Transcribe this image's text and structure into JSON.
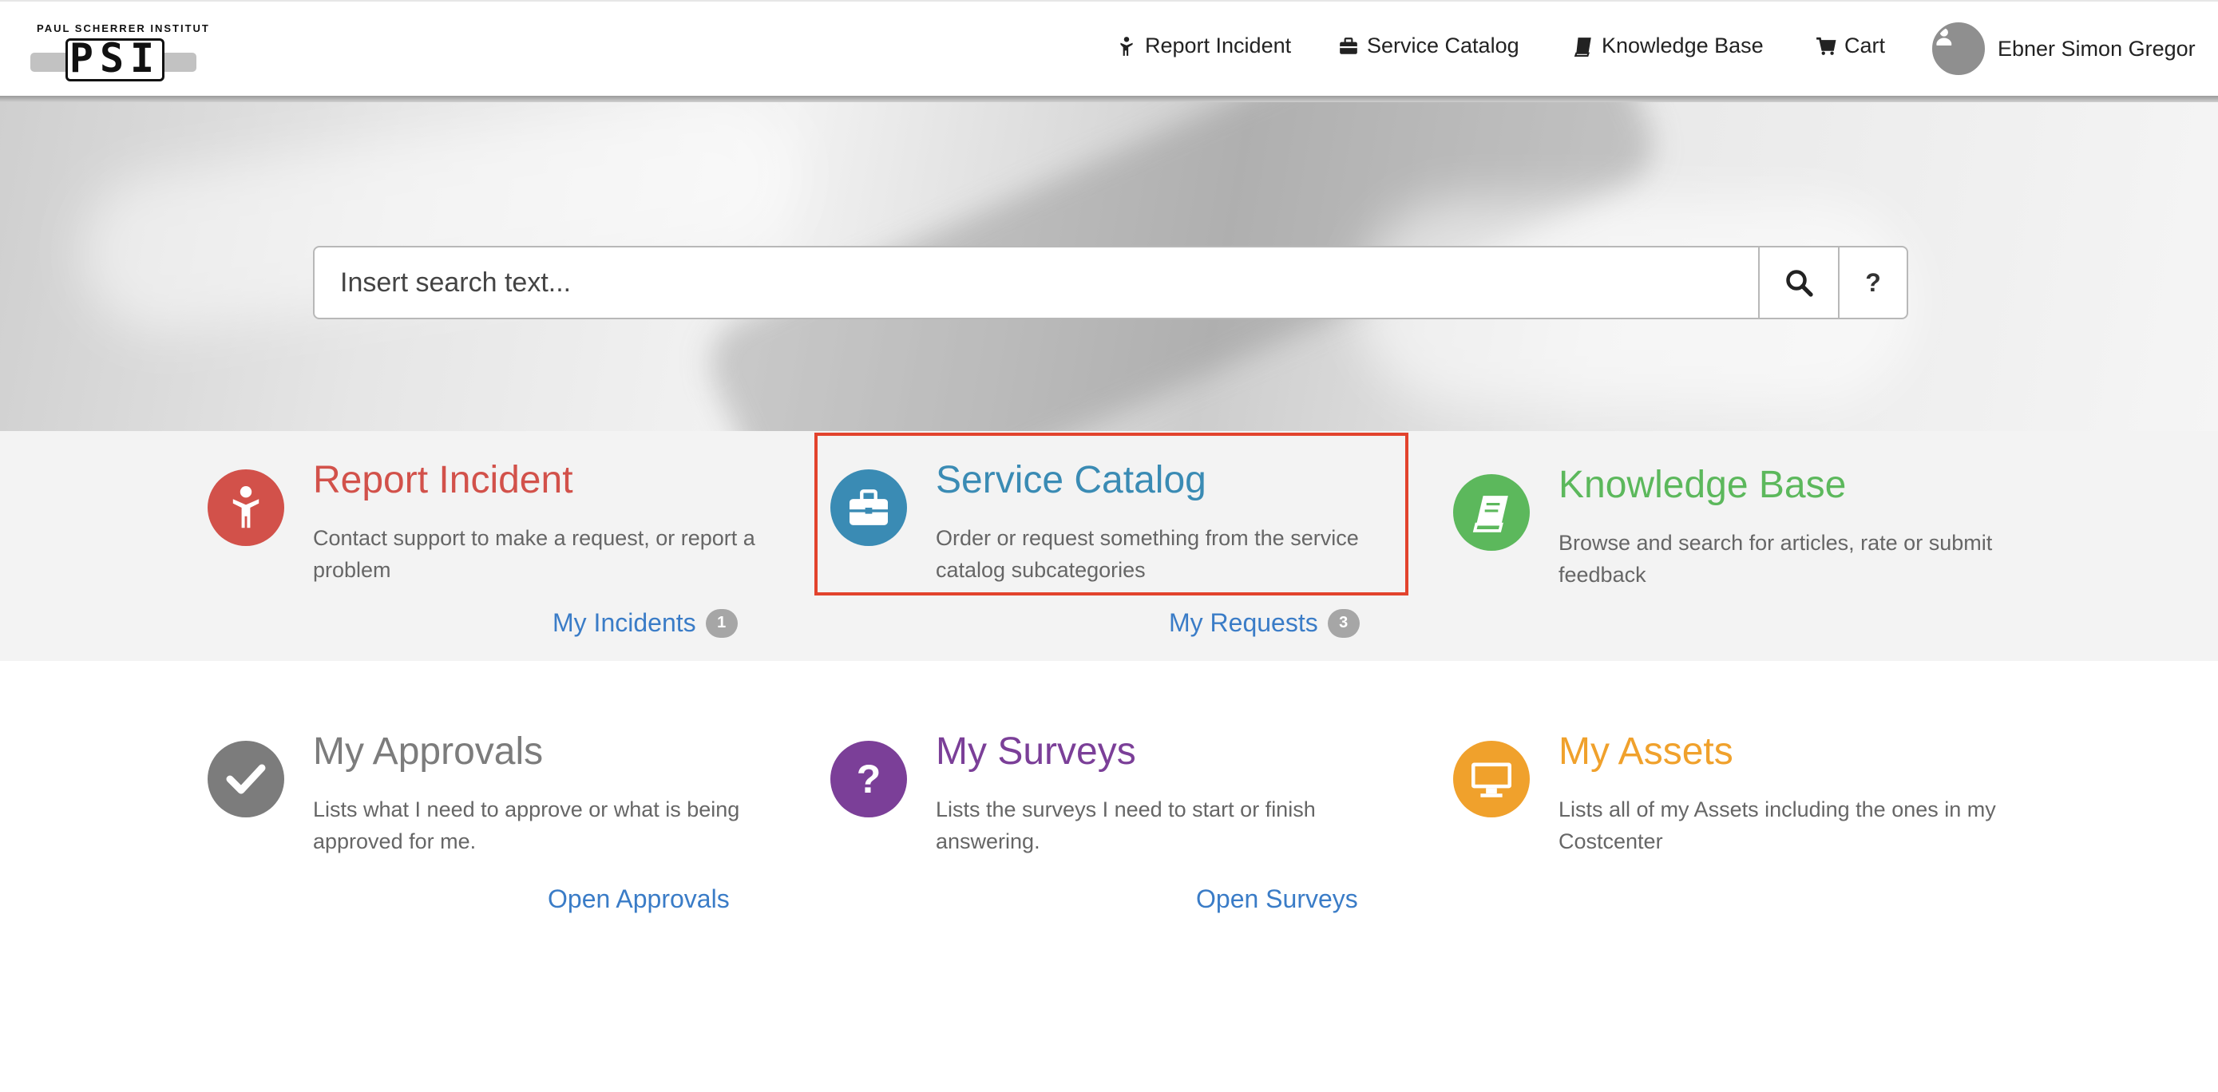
{
  "header": {
    "logo_text": "PAUL SCHERRER INSTITUT",
    "logo_word": "PSI",
    "nav": [
      {
        "icon": "person-icon",
        "label": "Report Incident"
      },
      {
        "icon": "briefcase-icon",
        "label": "Service Catalog"
      },
      {
        "icon": "book-icon",
        "label": "Knowledge Base"
      },
      {
        "icon": "cart-icon",
        "label": "Cart"
      }
    ],
    "user_name": "Ebner Simon Gregor"
  },
  "search": {
    "placeholder": "Insert search text...",
    "help_label": "?"
  },
  "tiles": {
    "report_incident": {
      "title": "Report Incident",
      "description": "Contact support to make a request, or report a problem",
      "link": "My Incidents",
      "badge": "1",
      "color": "#d2514a"
    },
    "service_catalog": {
      "title": "Service Catalog",
      "description": "Order or request something from the service catalog subcategories",
      "link": "My Requests",
      "badge": "3",
      "color": "#3a8bb4"
    },
    "knowledge_base": {
      "title": "Knowledge Base",
      "description": "Browse and search for articles, rate or submit feedback",
      "color": "#5cb85c"
    },
    "my_approvals": {
      "title": "My Approvals",
      "description": "Lists what I need to approve or what is being approved for me.",
      "link": "Open Approvals",
      "color": "#7c7c7c"
    },
    "my_surveys": {
      "title": "My Surveys",
      "description": "Lists the surveys I need to start or finish answering.",
      "link": "Open Surveys",
      "color": "#7b3f98"
    },
    "my_assets": {
      "title": "My Assets",
      "description": "Lists all of my Assets including the ones in my Costcenter",
      "color": "#f0a12c"
    }
  },
  "colors": {
    "link": "#3a7cc7",
    "highlight": "#e2432d"
  }
}
